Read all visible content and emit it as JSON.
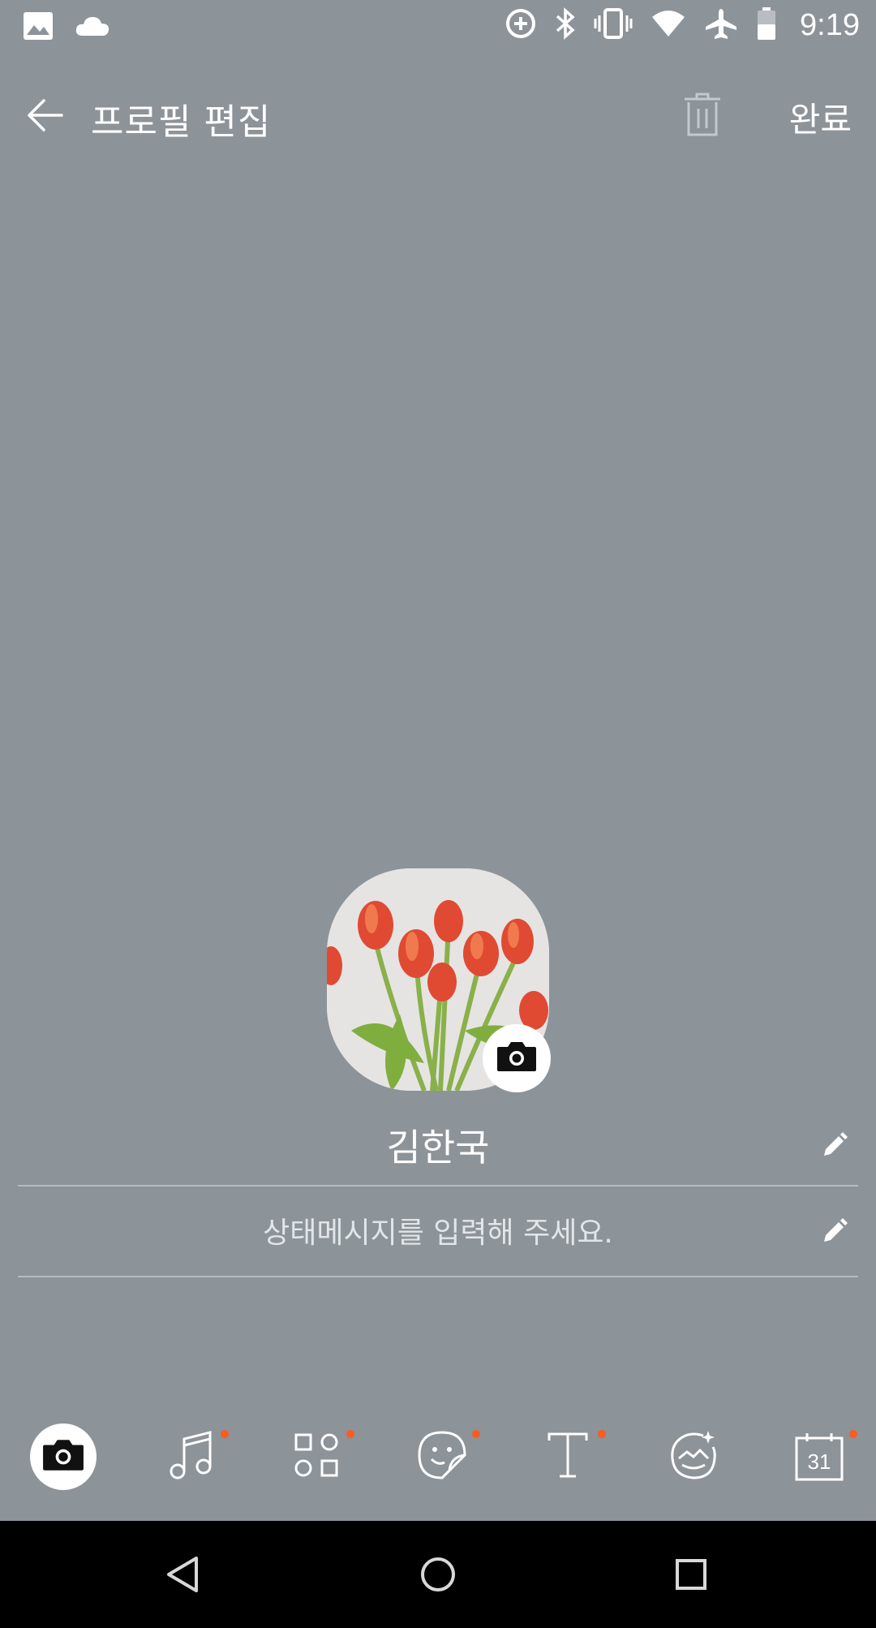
{
  "status_bar": {
    "time": "9:19",
    "left_icons": [
      "image-icon",
      "cloud-icon"
    ],
    "right_icons": [
      "data-saver-icon",
      "bluetooth-icon",
      "vibrate-icon",
      "wifi-icon",
      "airplane-icon",
      "battery-icon"
    ]
  },
  "app_bar": {
    "title": "프로필 편집",
    "done_label": "완료",
    "back_icon": "arrow-left-icon",
    "delete_icon": "trash-icon"
  },
  "profile": {
    "name": "김한국",
    "status_placeholder": "상태메시지를 입력해 주세요."
  },
  "toolbar": {
    "items": [
      {
        "icon": "camera-icon",
        "active": true,
        "dot": false
      },
      {
        "icon": "music-note-icon",
        "active": false,
        "dot": true
      },
      {
        "icon": "widgets-icon",
        "active": false,
        "dot": true
      },
      {
        "icon": "sticker-icon",
        "active": false,
        "dot": true
      },
      {
        "icon": "text-icon",
        "active": false,
        "dot": true
      },
      {
        "icon": "effect-icon",
        "active": false,
        "dot": false
      },
      {
        "icon": "calendar-icon",
        "label": "31",
        "active": false,
        "dot": true
      }
    ]
  },
  "colors": {
    "background": "#8c9399",
    "accent_dot": "#ff5a1f",
    "divider": "#b6bbbf"
  }
}
